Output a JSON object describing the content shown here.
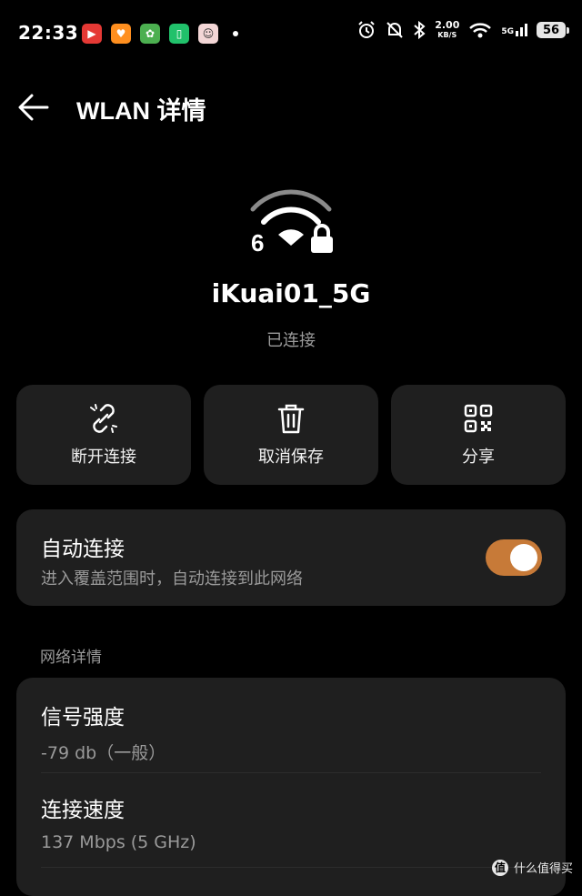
{
  "status_bar": {
    "time": "22:33",
    "notification_icons": [
      {
        "name": "video-app-icon",
        "color": "#e53935",
        "glyph": "▶"
      },
      {
        "name": "shopping-app-icon",
        "color": "#ff8f1f",
        "glyph": "♥"
      },
      {
        "name": "health-app-icon",
        "color": "#4caf50",
        "glyph": "✿"
      },
      {
        "name": "green-app-icon",
        "color": "#21c16b",
        "glyph": "▯"
      },
      {
        "name": "avatar-app-icon",
        "color": "#f3d6d6",
        "glyph": "☺"
      }
    ],
    "net_speed_value": "2.00",
    "net_speed_unit": "KB/S",
    "network_type": "5G",
    "battery": "56"
  },
  "header": {
    "title": "WLAN 详情"
  },
  "network": {
    "wifi_standard": "6",
    "ssid": "iKuai01_5G",
    "status": "已连接"
  },
  "actions": [
    {
      "label": "断开连接",
      "icon": "broken-link-icon"
    },
    {
      "label": "取消保存",
      "icon": "trash-icon"
    },
    {
      "label": "分享",
      "icon": "qr-code-icon"
    }
  ],
  "auto_connect": {
    "title": "自动连接",
    "subtitle": "进入覆盖范围时，自动连接到此网络",
    "enabled": true
  },
  "details_section_label": "网络详情",
  "details": [
    {
      "key": "信号强度",
      "value": "-79 db（一般）"
    },
    {
      "key": "连接速度",
      "value": "137 Mbps (5 GHz)"
    }
  ],
  "watermark": {
    "logo_text": "值",
    "text": "什么值得买"
  },
  "colors": {
    "background": "#000000",
    "card": "#1f1f1f",
    "accent": "#c77a38",
    "secondary_text": "#9a9a9a"
  }
}
